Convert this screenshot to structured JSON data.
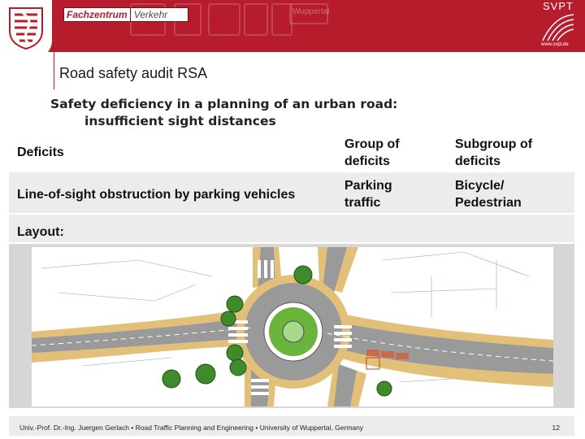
{
  "header": {
    "brand_box": "Fachzentrum",
    "brand_tail": "Verkehr",
    "sign_text": "Wuppertal",
    "svpt_name": "SVPT",
    "svpt_url": "www.svpt.de"
  },
  "title": "Road safety audit RSA",
  "subtitle": {
    "line1": "Safety deficiency in a planning of an urban road:",
    "line2": "insufficient sight distances"
  },
  "table": {
    "header": {
      "deficits": "Deficits",
      "group_l1": "Group of",
      "group_l2": "deficits",
      "subgroup_l1": "Subgroup of",
      "subgroup_l2": "deficits"
    },
    "row": {
      "deficit": "Line-of-sight obstruction by parking vehicles",
      "group_l1": "Parking",
      "group_l2": "traffic",
      "subgroup_l1": "Bicycle/",
      "subgroup_l2": "Pedestrian"
    },
    "layout_label": "Layout:"
  },
  "footer": {
    "text": "Univ.-Prof. Dr.-Ing. Juergen Gerlach • Road Traffic Planning and Engineering • University of Wuppertal, Germany",
    "page": "12"
  },
  "colors": {
    "brand_red": "#b61c2b",
    "row_gray": "#ececec",
    "road_gray": "#9a9a9a",
    "sidewalk_tan": "#e3c07a",
    "green_area": "#6bb43c"
  }
}
